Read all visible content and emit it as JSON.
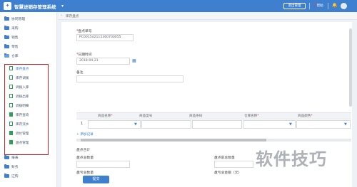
{
  "app": {
    "logo_glyph": "✦",
    "title": "智慧进销存管理系统",
    "title_caret": "▾"
  },
  "topbar": {
    "exit_label": "退出管理",
    "help_label": "❓帮助",
    "bell_icon": "🔔"
  },
  "sidebar": {
    "items": [
      {
        "label": "协同管理"
      },
      {
        "label": "采购"
      },
      {
        "label": "销售"
      },
      {
        "label": "零售"
      },
      {
        "label": "仓库"
      }
    ],
    "sub_items": [
      {
        "label": "库存盘点",
        "active": true
      },
      {
        "label": "库存调拨"
      },
      {
        "label": "调拨入库"
      },
      {
        "label": "调拨出库"
      },
      {
        "label": "调拨明细"
      },
      {
        "label": "库存查询"
      },
      {
        "label": "库存流水"
      },
      {
        "label": "调价管理"
      },
      {
        "label": "盘点管理"
      }
    ],
    "bottom_items": [
      {
        "label": "报表"
      },
      {
        "label": "财务"
      },
      {
        "label": "辽购"
      }
    ]
  },
  "breadcrumb": {
    "arrow": "‹",
    "text": "库存盘点"
  },
  "form": {
    "order_no_label": "盘点单号",
    "order_no_value": "PC0015d2115360700055",
    "date_label": "日期时间",
    "date_value": "2018-04-21",
    "remark_label": "备注",
    "table_headers": [
      "商品名称",
      "商品型号",
      "商品条码",
      "仓库名称",
      "商品颜色"
    ],
    "row_index": "1",
    "add_row_label": "+ 添加记录",
    "summary_title": "盘点合计",
    "fields": [
      {
        "label": "盘点总数量"
      },
      {
        "label": "盘点前总数量"
      },
      {
        "label": "盘亏总数量"
      },
      {
        "label": "盘亏总金额（元）"
      }
    ],
    "submit_label": "提交"
  },
  "watermark": "软件技巧",
  "colors": {
    "primary": "#3f7fd0",
    "highlight_border": "#c8252b",
    "doc_icon": "#2f9e5b"
  }
}
